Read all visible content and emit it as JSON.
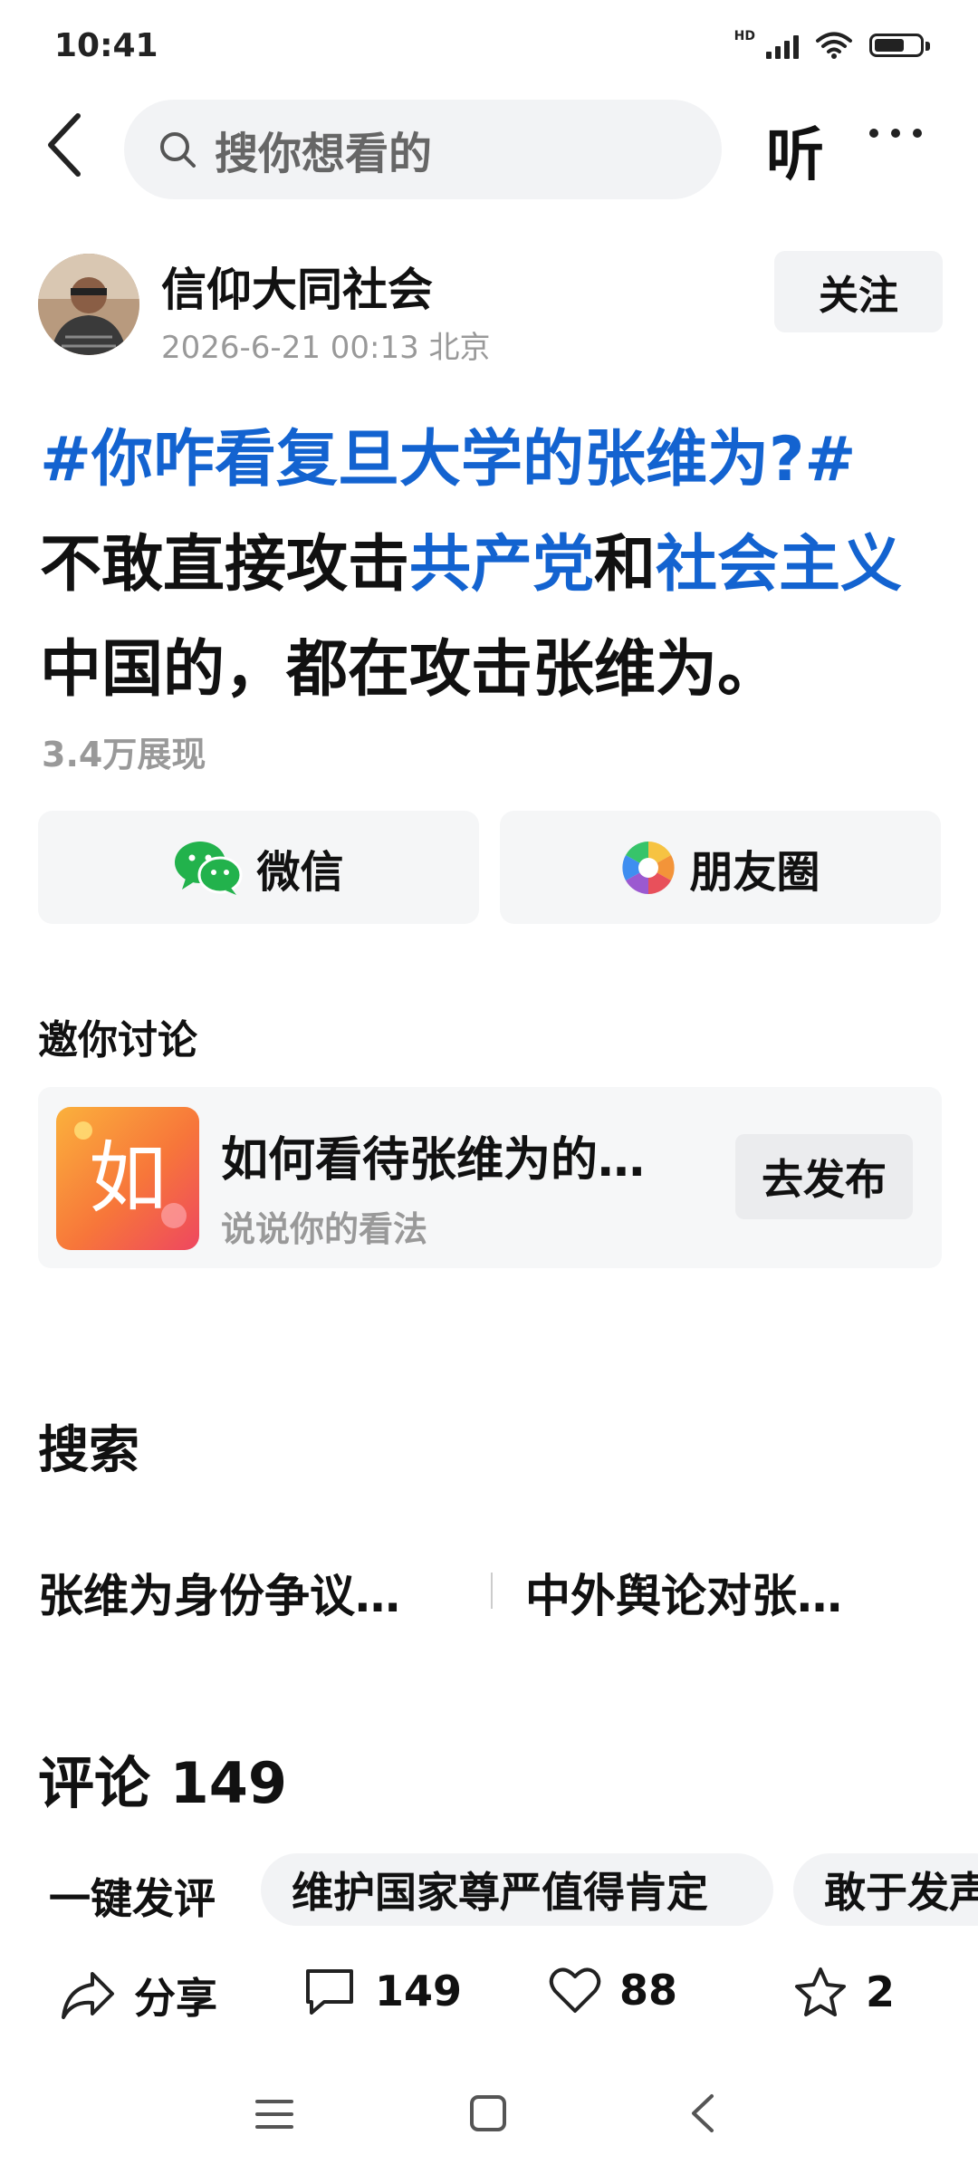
{
  "status": {
    "time": "10:41",
    "network": "HD"
  },
  "header": {
    "search_placeholder": "搜你想看的",
    "listen_label": "听"
  },
  "author": {
    "name": "信仰大同社会",
    "meta": "2026-6-21 00:13 北京",
    "follow_label": "关注"
  },
  "post": {
    "tag": "#你咋看复旦大学的张维为?#",
    "line_segments": [
      {
        "text": "不敢直接攻击",
        "link": false
      },
      {
        "text": "共产党",
        "link": true
      },
      {
        "text": "和",
        "link": false
      },
      {
        "text": "社会主义",
        "link": true
      },
      {
        "text": "中国的，都在攻击张维为。",
        "link": false
      }
    ],
    "views": "3.4万展现"
  },
  "share": {
    "wechat_label": "微信",
    "moments_label": "朋友圈"
  },
  "invite": {
    "heading": "邀你讨论",
    "logo_char": "如",
    "title": "如何看待张维为的…",
    "subtitle": "说说你的看法",
    "button_label": "去发布"
  },
  "search": {
    "heading": "搜索",
    "suggestions": [
      "张维为身份争议…",
      "中外舆论对张…"
    ]
  },
  "comments": {
    "title": "评论 149",
    "quick_reply_label": "一键发评",
    "chips": [
      "维护国家尊严值得肯定",
      "敢于发声"
    ]
  },
  "actions": {
    "share_label": "分享",
    "comment_count": "149",
    "like_count": "88",
    "favorite_count": "2"
  },
  "colors": {
    "link": "#1363d0",
    "muted": "#999999",
    "card_bg": "#f5f6f7"
  }
}
